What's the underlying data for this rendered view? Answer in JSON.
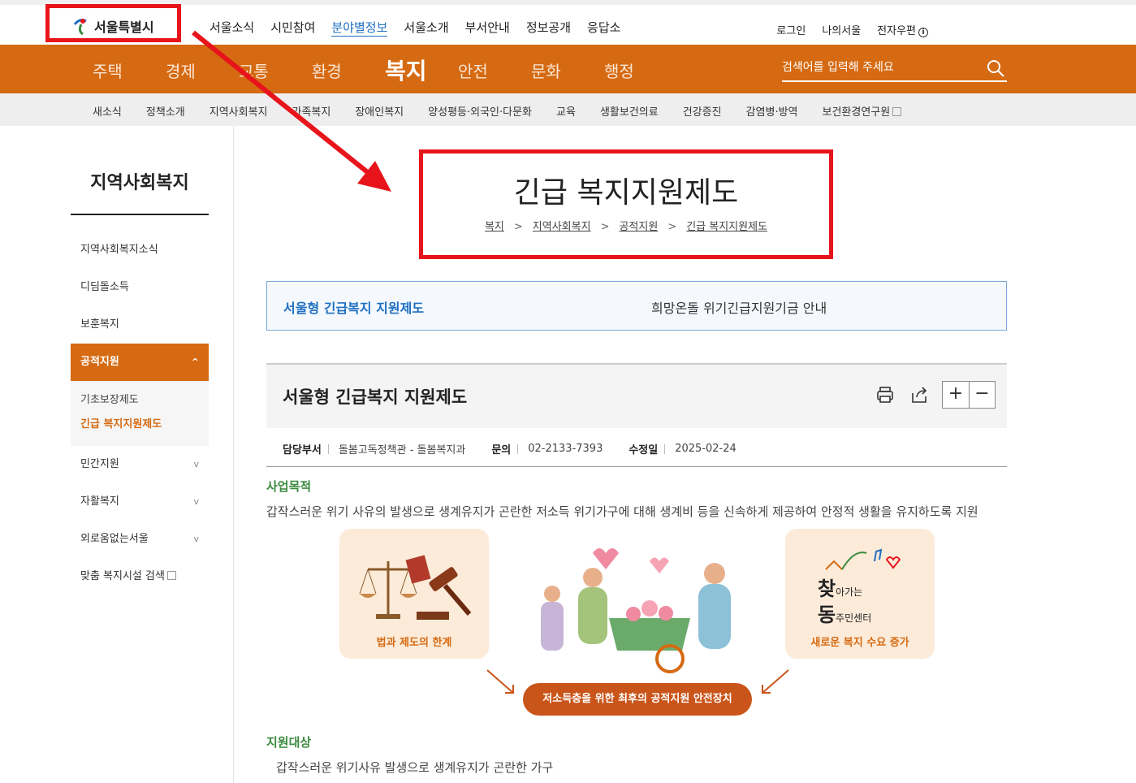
{
  "header": {
    "logo_text": "서울특별시",
    "top_nav": [
      "서울소식",
      "시민참여",
      "분야별정보",
      "서울소개",
      "부서안내",
      "정보공개",
      "응답소"
    ],
    "top_nav_active": "분야별정보",
    "utilities": {
      "login": "로그인",
      "my_seoul": "나의서울",
      "email": "전자우편",
      "info_glyph": "i"
    }
  },
  "main_nav": {
    "items": [
      "주택",
      "경제",
      "교통",
      "환경",
      "복지",
      "안전",
      "문화",
      "행정"
    ],
    "active": "복지"
  },
  "search": {
    "placeholder": "검색어를 입력해 주세요"
  },
  "sub_nav": {
    "items": [
      "새소식",
      "정책소개",
      "지역사회복지",
      "가족복지",
      "장애인복지",
      "양성평등·외국인·다문화",
      "교육",
      "생활보건의료",
      "건강증진",
      "감염병·방역",
      "보건환경연구원"
    ]
  },
  "sidebar": {
    "title": "지역사회복지",
    "items": [
      {
        "label": "지역사회복지소식"
      },
      {
        "label": "디딤돌소득"
      },
      {
        "label": "보훈복지"
      },
      {
        "label": "공적지원",
        "expanded": true,
        "chevron": "^"
      },
      {
        "label": "민간지원",
        "chevron": "v"
      },
      {
        "label": "자활복지",
        "chevron": "v"
      },
      {
        "label": "외로움없는서울",
        "chevron": "v"
      },
      {
        "label": "맞춤 복지시설 검색"
      }
    ],
    "sub_items": [
      "기초보장제도",
      "긴급 복지지원제도"
    ],
    "current": "긴급 복지지원제도"
  },
  "page": {
    "title": "긴급 복지지원제도",
    "breadcrumb": [
      "복지",
      "지역사회복지",
      "공적지원",
      "긴급 복지지원제도"
    ],
    "breadcrumb_sep": ">"
  },
  "tabs": [
    "서울형 긴급복지 지원제도",
    "희망온돌 위기긴급지원기금 안내"
  ],
  "section": {
    "title": "서울형 긴급복지 지원제도",
    "zoom_in": "+",
    "zoom_out": "−",
    "meta": {
      "dept_label": "담당부서",
      "dept_value": "돌봄고독정책관 - 돌봄복지과",
      "contact_label": "문의",
      "contact_value": "02-2133-7393",
      "modified_label": "수정일",
      "modified_value": "2025-02-24"
    },
    "purpose_heading": "사업목적",
    "purpose_text": "갑작스러운 위기 사유의 발생으로 생계유지가 곤란한 저소득 위기가구에 대해 생계비 등을 신속하게 제공하여 안정적 생활을 유지하도록 지원",
    "illustration": {
      "left_label": "법과 제도의 한계",
      "right_label": "새로운 복지 수요 증가",
      "right_logo_big1": "찾",
      "right_logo_small1": "아가는",
      "right_logo_big2": "동",
      "right_logo_small2": "주민센터",
      "center_pill": "저소득층을 위한 최후의 공적지원 안전장치"
    },
    "target_heading": "지원대상",
    "target_text": "갑작스러운 위기사유 발생으로 생계유지가 곤란한 가구"
  },
  "colors": {
    "brand_orange": "#d56a12",
    "link_blue": "#1f6fc2",
    "heading_green": "#3b8a3e",
    "annotation_red": "#e8141b"
  }
}
